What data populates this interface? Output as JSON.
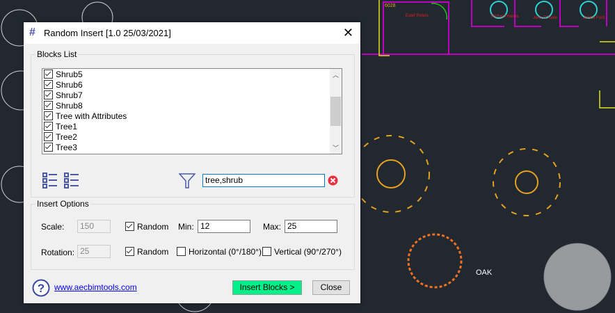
{
  "cad": {
    "room_tag": "6028",
    "names": [
      "Estef Peters",
      "Richard Hanes",
      "John O'Toole",
      "Janice Ford"
    ],
    "oak_label": "OAK"
  },
  "dialog": {
    "title": "Random Insert [1.0 25/03/2021]",
    "blocks_group": "Blocks List",
    "blocks": [
      {
        "label": "Shrub5",
        "checked": true
      },
      {
        "label": "Shrub6",
        "checked": true
      },
      {
        "label": "Shrub7",
        "checked": true
      },
      {
        "label": "Shrub8",
        "checked": true
      },
      {
        "label": "Tree with Attributes",
        "checked": true
      },
      {
        "label": "Tree1",
        "checked": true
      },
      {
        "label": "Tree2",
        "checked": true
      },
      {
        "label": "Tree3",
        "checked": true
      }
    ],
    "filter_value": "tree,shrub",
    "options_group": "Insert Options",
    "scale_label": "Scale:",
    "scale_value": "150",
    "random_label": "Random",
    "min_label": "Min:",
    "min_value": "12",
    "max_label": "Max:",
    "max_value": "25",
    "rotation_label": "Rotation:",
    "rotation_value": "25",
    "horizontal_label": "Horizontal (0°/180°)",
    "vertical_label": "Vertical (90°/270°)",
    "link": "www.aecbimtools.com",
    "insert_button": "Insert Blocks >",
    "close_button": "Close"
  }
}
